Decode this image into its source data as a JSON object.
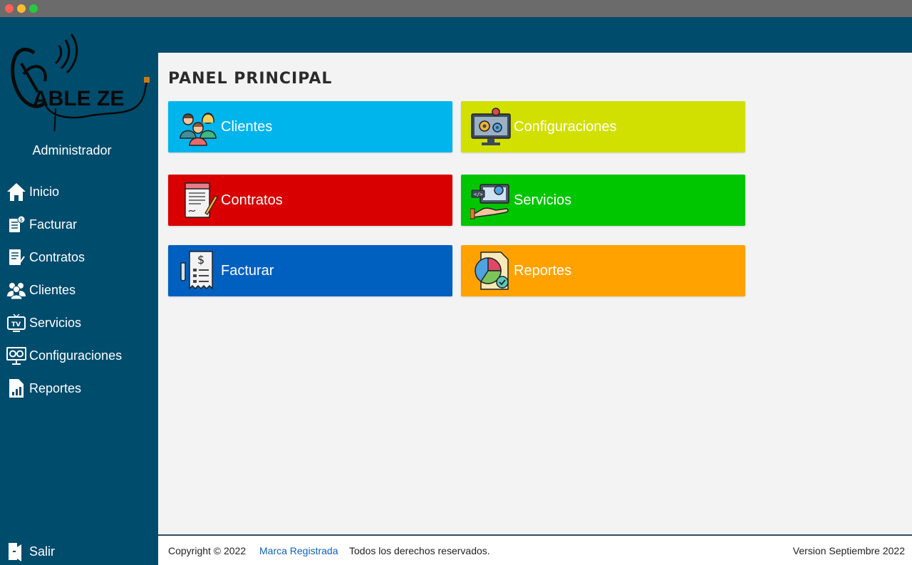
{
  "window": {
    "controls": [
      "close",
      "minimize",
      "maximize"
    ]
  },
  "sidebar": {
    "logo_text": "ABLE ZE",
    "role": "Administrador",
    "items": [
      {
        "label": "Inicio",
        "icon": "home-icon"
      },
      {
        "label": "Facturar",
        "icon": "invoice-icon"
      },
      {
        "label": "Contratos",
        "icon": "contract-icon"
      },
      {
        "label": "Clientes",
        "icon": "users-icon"
      },
      {
        "label": "Servicios",
        "icon": "tv-icon"
      },
      {
        "label": "Configuraciones",
        "icon": "settings-monitor-icon"
      },
      {
        "label": "Reportes",
        "icon": "report-icon"
      }
    ],
    "logout": {
      "label": "Salir",
      "icon": "logout-icon"
    }
  },
  "main": {
    "title": "PANEL PRINCIPAL",
    "tiles": [
      {
        "label": "Clientes",
        "color": "#00b4ec",
        "icon": "clients-group-icon"
      },
      {
        "label": "Configuraciones",
        "color": "#d2e000",
        "icon": "monitor-gears-icon"
      },
      {
        "label": "Contratos",
        "color": "#d80000",
        "icon": "contract-document-icon"
      },
      {
        "label": "Servicios",
        "color": "#00c600",
        "icon": "service-hand-icon"
      },
      {
        "label": "Facturar",
        "color": "#0060c0",
        "icon": "invoice-receipt-icon"
      },
      {
        "label": "Reportes",
        "color": "#ffa200",
        "icon": "pie-report-icon"
      }
    ]
  },
  "footer": {
    "copyright": "Copyright © 2022",
    "brand": "Marca Registrada",
    "rights": "Todos los derechos reservados.",
    "version": "Version Septiembre 2022"
  },
  "colors": {
    "sidebar": "#004c6d",
    "background": "#f3f3f3",
    "link": "#1160b8"
  }
}
